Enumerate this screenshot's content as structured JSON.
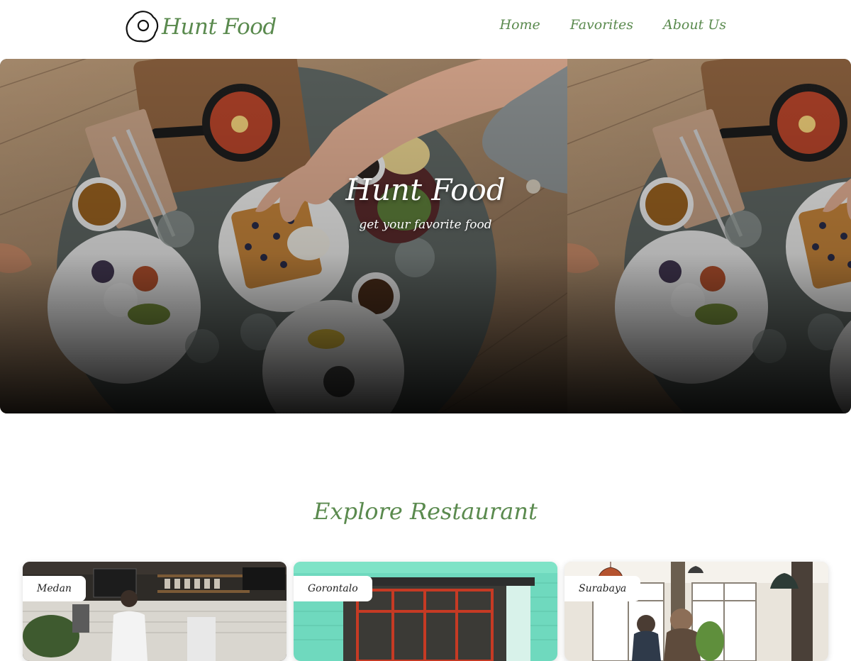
{
  "header": {
    "brand": "Hunt Food",
    "logo_icon": "fried-egg-icon",
    "nav": [
      {
        "label": "Home"
      },
      {
        "label": "Favorites"
      },
      {
        "label": "About Us"
      }
    ]
  },
  "hero": {
    "title": "Hunt Food",
    "subtitle": "get your favorite food"
  },
  "explore": {
    "title": "Explore Restaurant",
    "cards": [
      {
        "city": "Medan"
      },
      {
        "city": "Gorontalo"
      },
      {
        "city": "Surabaya"
      }
    ]
  },
  "colors": {
    "accent": "#5a8a4e",
    "background": "#ffffff"
  }
}
